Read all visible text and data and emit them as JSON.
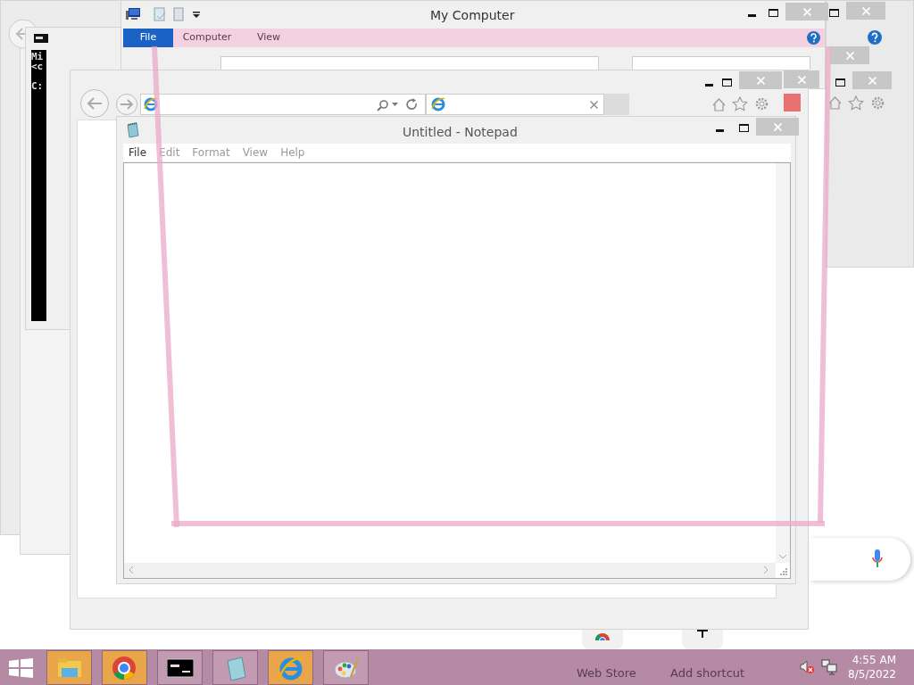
{
  "console": {
    "lines": [
      "Mi",
      "<c",
      "C:"
    ]
  },
  "explorer": {
    "title": "My Computer",
    "ribbon_tabs": [
      {
        "label": "File",
        "selected": true
      },
      {
        "label": "Computer",
        "selected": false
      },
      {
        "label": "View",
        "selected": false
      }
    ]
  },
  "notepad": {
    "title": "Untitled - Notepad",
    "menu": [
      {
        "label": "File",
        "disabled": false
      },
      {
        "label": "Edit",
        "disabled": true
      },
      {
        "label": "Format",
        "disabled": true
      },
      {
        "label": "View",
        "disabled": true
      },
      {
        "label": "Help",
        "disabled": true
      }
    ]
  },
  "new_tab_page": {
    "shortcuts": [
      "Web Store",
      "Add shortcut"
    ]
  },
  "taskbar": {
    "apps": [
      {
        "kind": "folder",
        "highlighted": true
      },
      {
        "kind": "chrome",
        "highlighted": true
      },
      {
        "kind": "console",
        "highlighted": false
      },
      {
        "kind": "notepad",
        "highlighted": false
      },
      {
        "kind": "ie",
        "highlighted": true
      },
      {
        "kind": "paint",
        "highlighted": false
      }
    ],
    "clock": {
      "time": "4:55 AM",
      "date": "8/5/2022"
    }
  }
}
